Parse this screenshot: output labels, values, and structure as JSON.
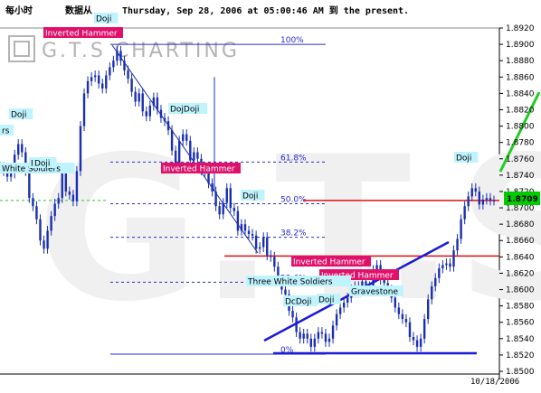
{
  "header": {
    "timeframe": "每小时",
    "source_label": "数据从",
    "date_range": "Thursday, Sep 28, 2006 at 05:00:46 AM 到  the present."
  },
  "watermark": "G.T.S CHARTING",
  "colors": {
    "fib": "#2a2ad0",
    "price": "#1a2fb0",
    "support": "#e01010",
    "trend": "#1a1ad8",
    "arrow": "#22cc22",
    "label_pink": "#e0116b",
    "label_cyan": "#bff4ff",
    "current_bg": "#00cc00"
  },
  "chart_data": {
    "type": "candlestick",
    "y_axis_ticks": [
      "1.8920",
      "1.8900",
      "1.8880",
      "1.8860",
      "1.8840",
      "1.8820",
      "1.8800",
      "1.8780",
      "1.8760",
      "1.8740",
      "1.8720",
      "1.8700",
      "1.8680",
      "1.8660",
      "1.8640",
      "1.8620",
      "1.8600",
      "1.8580",
      "1.8560",
      "1.8540",
      "1.8520",
      "1.8500"
    ],
    "ylim": [
      1.85,
      1.892
    ],
    "current_price": "1.8709",
    "x_axis_label": "10/18/2006",
    "series": [
      {
        "x": [
          0,
          1,
          2,
          3,
          4,
          5,
          6,
          7,
          8,
          9,
          10,
          11,
          12,
          13,
          14,
          15,
          16,
          17,
          18,
          19,
          20,
          21,
          22,
          23,
          24,
          25,
          26,
          27,
          28,
          29,
          30,
          31,
          32,
          33,
          34,
          35,
          36,
          37,
          38,
          39,
          40,
          41,
          42,
          43,
          44,
          45,
          46,
          47,
          48,
          49,
          50,
          51,
          52,
          53,
          54,
          55,
          56,
          57,
          58,
          59,
          60,
          61,
          62,
          63,
          64,
          65,
          66,
          67,
          68,
          69,
          70,
          71,
          72,
          73,
          74,
          75,
          76,
          77,
          78,
          79,
          80,
          81,
          82,
          83,
          84,
          85,
          86,
          87,
          88,
          89,
          90,
          91,
          92,
          93,
          94,
          95,
          96,
          97,
          98,
          99,
          100,
          101,
          102,
          103,
          104,
          105,
          106,
          107,
          108,
          109,
          110,
          111,
          112,
          113,
          114,
          115,
          116,
          117,
          118,
          119,
          120,
          121,
          122,
          123,
          124,
          125,
          126,
          127,
          128,
          129,
          130,
          131,
          132,
          133,
          134,
          135
        ],
        "y": [
          1.875,
          1.8745,
          1.8738,
          1.8742,
          1.8765,
          1.8778,
          1.8768,
          1.8745,
          1.8712,
          1.8702,
          1.8686,
          1.866,
          1.865,
          1.8672,
          1.869,
          1.8705,
          1.8712,
          1.8742,
          1.872,
          1.8716,
          1.8708,
          1.8745,
          1.88,
          1.884,
          1.8855,
          1.886,
          1.8862,
          1.8852,
          1.8846,
          1.8862,
          1.8872,
          1.888,
          1.8892,
          1.888,
          1.8868,
          1.8858,
          1.8842,
          1.883,
          1.884,
          1.8818,
          1.8812,
          1.8825,
          1.8835,
          1.882,
          1.881,
          1.8806,
          1.8795,
          1.877,
          1.8752,
          1.8782,
          1.879,
          1.8782,
          1.8758,
          1.8768,
          1.876,
          1.8746,
          1.8744,
          1.873,
          1.872,
          1.8702,
          1.8692,
          1.8706,
          1.8724,
          1.87,
          1.8696,
          1.8672,
          1.868,
          1.8672,
          1.8668,
          1.8666,
          1.865,
          1.8652,
          1.8664,
          1.8642,
          1.864,
          1.8628,
          1.8612,
          1.86,
          1.8594,
          1.8574,
          1.8566,
          1.8548,
          1.854,
          1.8546,
          1.854,
          1.853,
          1.854,
          1.8548,
          1.8546,
          1.8536,
          1.854,
          1.8556,
          1.857,
          1.8578,
          1.8584,
          1.859,
          1.86,
          1.8604,
          1.8602,
          1.861,
          1.86,
          1.8604,
          1.8624,
          1.863,
          1.8612,
          1.8608,
          1.86,
          1.859,
          1.8578,
          1.857,
          1.8564,
          1.856,
          1.8542,
          1.8538,
          1.853,
          1.854,
          1.8564,
          1.8588,
          1.8604,
          1.8614,
          1.8626,
          1.863,
          1.8632,
          1.8628,
          1.8648,
          1.8662,
          1.8686,
          1.8702,
          1.8714,
          1.8724,
          1.872,
          1.8704,
          1.871,
          1.8712,
          1.8709,
          1.8709
        ]
      }
    ],
    "fibonacci": [
      {
        "label": "100%",
        "value": 1.89
      },
      {
        "label": "61.8%",
        "value": 1.8756
      },
      {
        "label": "50.0%",
        "value": 1.8705
      },
      {
        "label": "38.2%",
        "value": 1.8664
      },
      {
        "label": "23.6%",
        "value": 1.8609
      },
      {
        "label": "0%",
        "value": 1.8521
      }
    ],
    "support_lines": [
      1.8641,
      1.8709
    ],
    "annotations": [
      {
        "text": "Doji",
        "kind": "cyan"
      },
      {
        "text": "Inverted Hammer",
        "kind": "pink"
      },
      {
        "text": "Doji",
        "kind": "cyan"
      },
      {
        "text": "DojDoji",
        "kind": "cyan"
      },
      {
        "text": "Doji",
        "kind": "cyan"
      },
      {
        "text": "White Soldiers",
        "kind": "cyan"
      },
      {
        "text": "Doji",
        "kind": "cyan"
      },
      {
        "text": "Inverted Hammer",
        "kind": "pink"
      },
      {
        "text": "Doji",
        "kind": "cyan"
      },
      {
        "text": "Inverted Hammer",
        "kind": "pink"
      },
      {
        "text": "Inverted Hammer",
        "kind": "pink"
      },
      {
        "text": "Three White Soldiers",
        "kind": "cyan"
      },
      {
        "text": "DcDoji",
        "kind": "cyan"
      },
      {
        "text": "Doji",
        "kind": "cyan"
      },
      {
        "text": "Gravestone",
        "kind": "cyan"
      },
      {
        "text": "Doji",
        "kind": "cyan"
      },
      {
        "text": "rs",
        "kind": "cyan"
      }
    ]
  }
}
